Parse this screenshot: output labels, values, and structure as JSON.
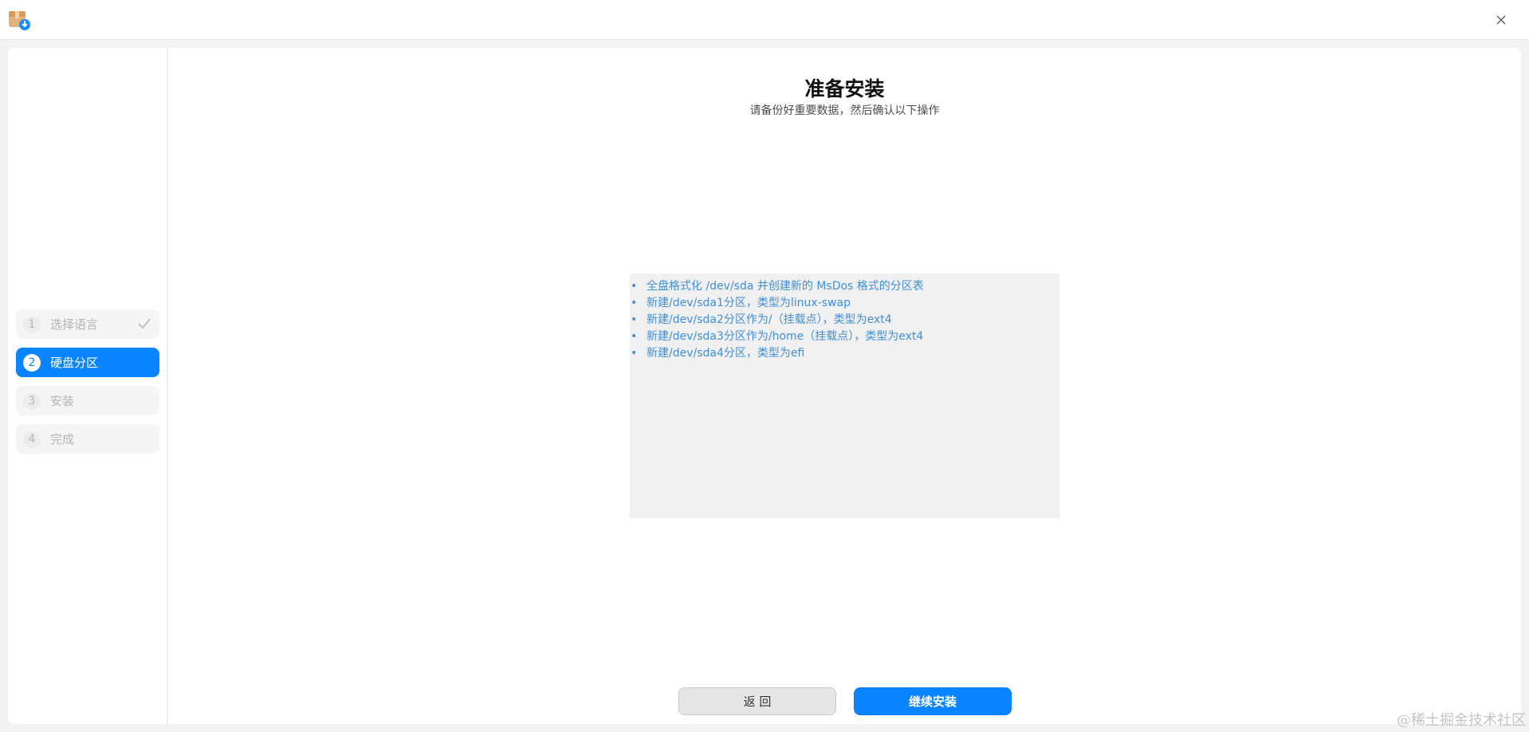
{
  "window": {
    "app_icon": "installer-package-icon",
    "close_icon": "close-icon"
  },
  "sidebar": {
    "steps": [
      {
        "number": "1",
        "label": "选择语言",
        "state": "done"
      },
      {
        "number": "2",
        "label": "硬盘分区",
        "state": "active"
      },
      {
        "number": "3",
        "label": "安装",
        "state": "pending"
      },
      {
        "number": "4",
        "label": "完成",
        "state": "pending"
      }
    ]
  },
  "main": {
    "title": "准备安装",
    "subtitle": "请备份好重要数据，然后确认以下操作",
    "operations": [
      "全盘格式化 /dev/sda 并创建新的 MsDos 格式的分区表",
      "新建/dev/sda1分区，类型为linux-swap",
      "新建/dev/sda2分区作为/（挂载点），类型为ext4",
      "新建/dev/sda3分区作为/home（挂载点），类型为ext4",
      "新建/dev/sda4分区，类型为efi"
    ],
    "back_label": "返 回",
    "continue_label": "继续安装"
  },
  "watermark": "@稀土掘金技术社区",
  "colors": {
    "accent": "#0a84ff",
    "operation_text": "#3f8fd8"
  }
}
